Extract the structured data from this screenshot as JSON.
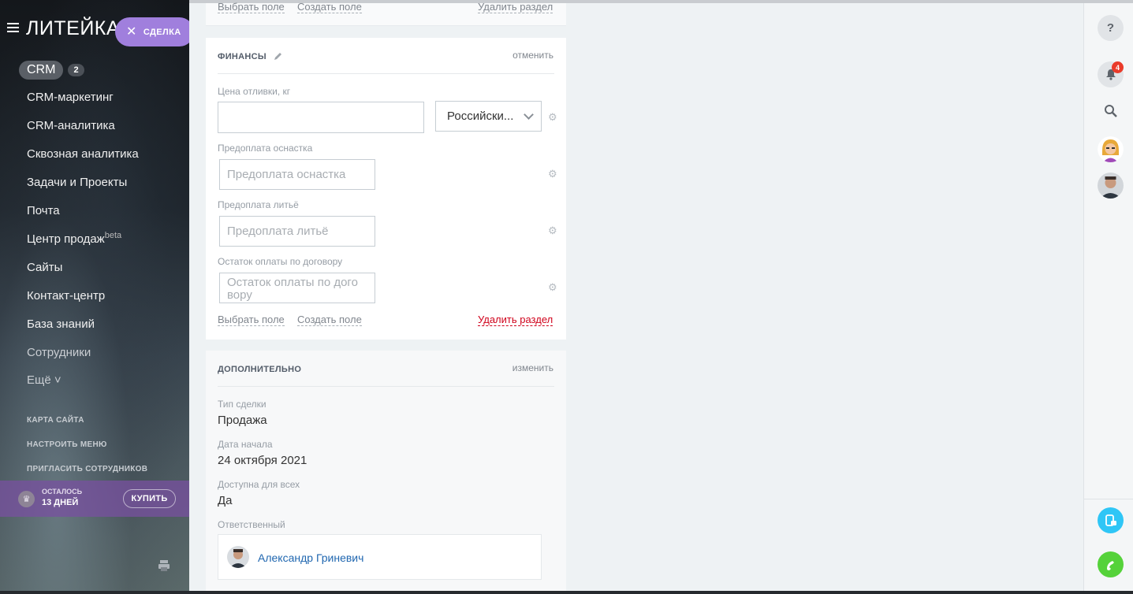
{
  "sidebar": {
    "logo": "ЛИТЕЙКА",
    "deal_pill": {
      "close": "✕",
      "label": "СДЕЛКА"
    },
    "crm": {
      "label": "CRM",
      "badge": "2"
    },
    "items": [
      {
        "label": "CRM-маркетинг"
      },
      {
        "label": "CRM-аналитика"
      },
      {
        "label": "Сквозная аналитика"
      },
      {
        "label": "Задачи и Проекты"
      },
      {
        "label": "Почта"
      },
      {
        "label": "Центр продаж",
        "sup": "beta"
      },
      {
        "label": "Сайты"
      },
      {
        "label": "Контакт-центр"
      },
      {
        "label": "База знаний"
      },
      {
        "label": "Сотрудники"
      },
      {
        "label": "Ещё ˅"
      }
    ],
    "links": [
      "КАРТА САЙТА",
      "НАСТРОИТЬ МЕНЮ",
      "ПРИГЛАСИТЬ СОТРУДНИКОВ"
    ],
    "trial": {
      "line1": "ОСТАЛОСЬ",
      "line2": "13 ДНЕЙ",
      "buy": "КУПИТЬ"
    }
  },
  "top_card": {
    "choose_field": "Выбрать поле",
    "create_field": "Создать поле",
    "delete_section": "Удалить раздел"
  },
  "finance": {
    "title": "ФИНАНСЫ",
    "action": "отменить",
    "fields": [
      {
        "label": "Цена отливки, кг",
        "value": "",
        "placeholder": ""
      },
      {
        "label": "Предоплата оснастка",
        "placeholder": "Предоплата оснастка"
      },
      {
        "label": "Предоплата литьё",
        "placeholder": "Предоплата литьё"
      },
      {
        "label": "Остаток оплаты по договору",
        "placeholder": "Остаток оплаты по дого вору"
      }
    ],
    "currency": "Российски...",
    "choose_field": "Выбрать поле",
    "create_field": "Создать поле",
    "delete_section": "Удалить раздел"
  },
  "additional": {
    "title": "ДОПОЛНИТЕЛЬНО",
    "action": "изменить",
    "fields": [
      {
        "label": "Тип сделки",
        "value": "Продажа"
      },
      {
        "label": "Дата начала",
        "value": "24 октября 2021"
      },
      {
        "label": "Доступна для всех",
        "value": "Да"
      }
    ],
    "responsible_label": "Ответственный",
    "responsible_name": "Александр Гриневич"
  },
  "rightbar": {
    "help": "?",
    "notifications_count": "4"
  },
  "colors": {
    "accent_purple": "#a07fdd",
    "link_blue": "#2067b0",
    "danger_red": "#d0021b",
    "chat_blue": "#2fc6f6",
    "phone_green": "#55d23a"
  }
}
